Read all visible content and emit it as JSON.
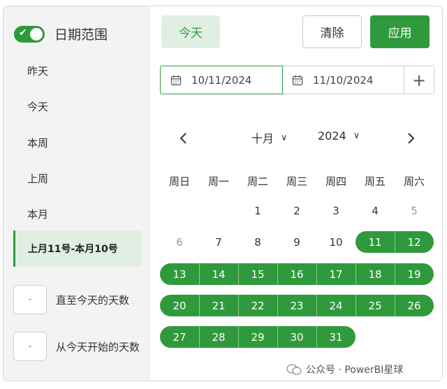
{
  "sidebar": {
    "toggle_label": "日期范围",
    "toggle_on": true,
    "items": [
      {
        "label": "昨天"
      },
      {
        "label": "今天"
      },
      {
        "label": "本周"
      },
      {
        "label": "上周"
      },
      {
        "label": "本月"
      }
    ],
    "active_item": "上月11号-本月10号",
    "days_until_today": {
      "value": "-",
      "label": "直至今天的天数"
    },
    "days_from_today": {
      "value": "-",
      "label": "从今天开始的天数"
    }
  },
  "header": {
    "today_label": "今天",
    "clear_label": "清除",
    "apply_label": "应用"
  },
  "range": {
    "start": "10/11/2024",
    "end": "11/10/2024",
    "add_label": "+"
  },
  "calendar": {
    "month": "十月",
    "year": "2024",
    "weekdays": [
      "周日",
      "周一",
      "周二",
      "周三",
      "周四",
      "周五",
      "周六"
    ],
    "weeks": [
      [
        {
          "d": ""
        },
        {
          "d": ""
        },
        {
          "d": "1"
        },
        {
          "d": "2"
        },
        {
          "d": "3"
        },
        {
          "d": "4"
        },
        {
          "d": "5"
        }
      ],
      [
        {
          "d": "6"
        },
        {
          "d": "7"
        },
        {
          "d": "8"
        },
        {
          "d": "9"
        },
        {
          "d": "10"
        },
        {
          "d": "11"
        },
        {
          "d": "12"
        }
      ],
      [
        {
          "d": "13"
        },
        {
          "d": "14"
        },
        {
          "d": "15"
        },
        {
          "d": "16"
        },
        {
          "d": "17"
        },
        {
          "d": "18"
        },
        {
          "d": "19"
        }
      ],
      [
        {
          "d": "20"
        },
        {
          "d": "21"
        },
        {
          "d": "22"
        },
        {
          "d": "23"
        },
        {
          "d": "24"
        },
        {
          "d": "25"
        },
        {
          "d": "26"
        }
      ],
      [
        {
          "d": "27"
        },
        {
          "d": "28"
        },
        {
          "d": "29"
        },
        {
          "d": "30"
        },
        {
          "d": "31"
        },
        {
          "d": ""
        },
        {
          "d": ""
        }
      ]
    ],
    "selected_start_day": 11,
    "selected_end_day": 31,
    "muted_days": [
      "5",
      "6"
    ]
  },
  "watermark": "公众号 · PowerBI星球",
  "colors": {
    "accent": "#2f9a3c",
    "accent_light": "#e1efe2"
  }
}
